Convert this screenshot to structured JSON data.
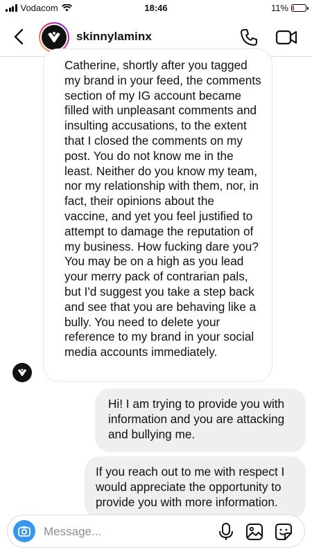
{
  "status_bar": {
    "carrier": "Vodacom",
    "time": "18:46",
    "battery": "11%",
    "battery_level": 0.11,
    "icons": [
      "signal-icon",
      "wifi-icon",
      "battery-icon"
    ]
  },
  "header": {
    "username": "skinnylaminx",
    "icons": [
      "back-icon",
      "phone-icon",
      "video-camera-icon"
    ]
  },
  "messages": [
    {
      "sender": "skinnylaminx",
      "direction": "incoming",
      "lines": [
        "Catherine, shortly after you tagged",
        "my brand in your feed, the comments",
        "section of my IG account became",
        "filled with unpleasant comments and",
        "insulting accusations, to the extent",
        "that I closed the comments on my",
        "post. You do not know me in the",
        "least. Neither do you know my team,",
        "nor my relationship with them, nor, in",
        "fact, their opinions about the",
        "vaccine, and yet you feel justified to",
        "attempt to damage the reputation of",
        "my business. How fucking dare you?",
        "You may be on a high as you lead",
        "your merry pack of contrarian pals,",
        "but I'd suggest you take a step back",
        "and see that you are behaving like a",
        "bully. You need to delete your",
        "reference to my brand in your social",
        "media accounts immediately."
      ]
    },
    {
      "direction": "outgoing",
      "lines": [
        "Hi! I am trying to provide you with",
        "information and you are attacking",
        "and bullying me."
      ]
    },
    {
      "direction": "outgoing",
      "lines": [
        "If you reach out to me with respect I",
        "would appreciate the opportunity to",
        "provide you with more information."
      ]
    }
  ],
  "composer": {
    "placeholder": "Message...",
    "value": "",
    "icons": [
      "camera-icon",
      "microphone-icon",
      "gallery-icon",
      "sticker-icon"
    ]
  },
  "colors": {
    "accent": "#3797f0",
    "outgoing_bubble": "#efefef",
    "incoming_bubble": "#ffffff",
    "battery_low": "#e0312b"
  }
}
